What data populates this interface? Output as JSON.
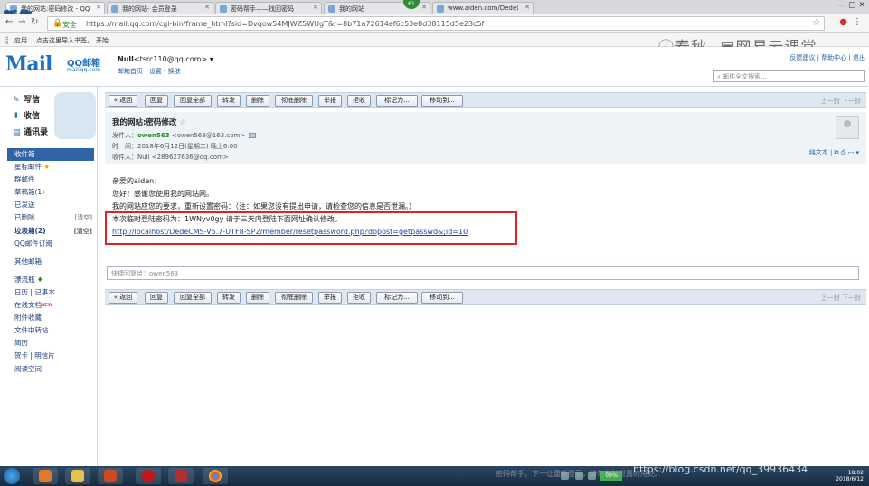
{
  "browser": {
    "tabs": [
      {
        "title": "我的网站:密码修改 - QQ"
      },
      {
        "title": "我的网站- 会员登录"
      },
      {
        "title": "密码帮手——找回密码"
      },
      {
        "title": "我的网站"
      },
      {
        "title": "www.aiden.com/Dede("
      }
    ],
    "pause_badge": "暂停",
    "tab_badge": "61",
    "secure_label": "安全",
    "url": "https://mail.qq.com/cgi-bin/frame_html?sid=Dvqow54MJWZ5WUgT&r=8b71a72614ef6c53e8d38115d5e23c5f",
    "bookmarks": {
      "apps": "应用",
      "import_hint": "点击这里导入书签。",
      "start": "开始"
    }
  },
  "watermark": {
    "brand1": "春秋",
    "brand2": "网易云课堂"
  },
  "header": {
    "logo_text": "Mail",
    "logo_cn": "QQ邮箱",
    "logo_sub": "mail.qq.com",
    "user_name": "Null",
    "user_email": "<tsrc110@qq.com>",
    "links": [
      "邮箱首页",
      "设置",
      "换肤"
    ],
    "top_links": [
      "反馈建议",
      "帮助中心",
      "退出"
    ],
    "search_placeholder": "邮件全文搜索..."
  },
  "sidebar": {
    "compose": "写信",
    "inbox": "收信",
    "contacts": "通讯录",
    "folders": [
      {
        "label": "收件箱"
      },
      {
        "label": "星标邮件"
      },
      {
        "label": "群邮件"
      },
      {
        "label": "草稿箱(1)"
      },
      {
        "label": "已发送"
      },
      {
        "label": "已删除",
        "aux": "[清空]"
      },
      {
        "label": "垃圾箱(2)",
        "aux": "[清空]"
      },
      {
        "label": "QQ邮件订阅"
      }
    ],
    "other_mailbox": "其他邮箱",
    "tools": [
      {
        "label": "漂流瓶"
      },
      {
        "label": "日历 | 记事本"
      },
      {
        "label": "在线文档",
        "badge": "NEW"
      },
      {
        "label": "附件收藏"
      },
      {
        "label": "文件中转站"
      },
      {
        "label": "简历"
      },
      {
        "label": "贺卡 | 明信片"
      },
      {
        "label": "阅读空间"
      }
    ]
  },
  "toolbar": {
    "buttons": [
      "« 返回",
      "回复",
      "回复全部",
      "转发",
      "删除",
      "彻底删除",
      "举报",
      "拒收",
      "标记为...",
      "移动到..."
    ],
    "pager_prev": "上一封",
    "pager_next": "下一封"
  },
  "mail": {
    "subject": "我的网站:密码修改",
    "sender_label": "发件人：",
    "sender_name": "owen563",
    "sender_email": "<owen563@163.com>",
    "time_label": "时　间：",
    "time_value": "2018年6月12日(星期二) 晚上6:00",
    "to_label": "收件人：",
    "to_value": "Null <289627636@qq.com>",
    "plain_text": "纯文本",
    "greeting": "亲爱的aiden：",
    "line1": "您好！感谢您使用我的网站网。",
    "line2": "我的网站应您的要求，重新设置密码：（注：如果您没有提出申请，请检查您的信息是否泄漏。）",
    "line3": "本次临时登陆密码为：1WNyv0gy 请于三天内登陆下面网址确认修改。",
    "link": "http://localhost/DedeCMS-V5.7-UTF8-SP2/member/resetpassword.php?dopost=getpasswd&;id=10"
  },
  "reply": {
    "placeholder": "快捷回复给：owen563"
  },
  "taskbar": {
    "battery": "99%",
    "csdn": "https://blog.csdn.net/qq_39936434",
    "faded_text": "密码帮手，下一让重新登录，请勿单独泄露的用处。",
    "clock_time": "18:02",
    "clock_date": "2018/6/12"
  }
}
